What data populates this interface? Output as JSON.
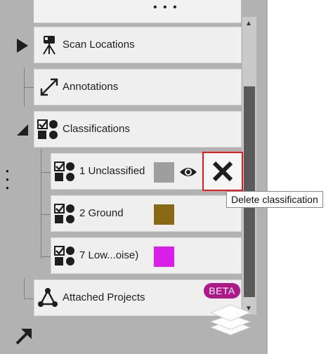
{
  "panel": {
    "rows": {
      "scan_locations": "Scan Locations",
      "annotations": "Annotations",
      "classifications": "Classifications",
      "attached_projects": "Attached Projects"
    },
    "classes": [
      {
        "label": "1 Unclassified",
        "color": "#9e9e9e"
      },
      {
        "label": "2 Ground",
        "color": "#8b6914"
      },
      {
        "label": "7 Low...oise)",
        "color": "#d81ee8"
      }
    ],
    "badge": "BETA",
    "tooltip": "Delete classification"
  },
  "colors": {
    "panel_bg": "#b2b2b2",
    "row_bg": "#efefef",
    "delete_outline": "#e11b22",
    "beta_bg": "#b01789",
    "scroll_thumb": "#5a5a5a"
  },
  "icons": {
    "top_menu": "ellipsis-horizontal-icon",
    "side_menu": "ellipsis-vertical-icon",
    "scan": "scanner-tripod-icon",
    "annotations": "diagonal-arrow-icon",
    "classifications": "shapes-check-icon",
    "visibility": "eye-icon",
    "delete": "close-x-icon",
    "attached": "network-triangle-icon",
    "layers": "layers-stack-icon",
    "expand": "diagonal-expand-arrow-icon"
  }
}
